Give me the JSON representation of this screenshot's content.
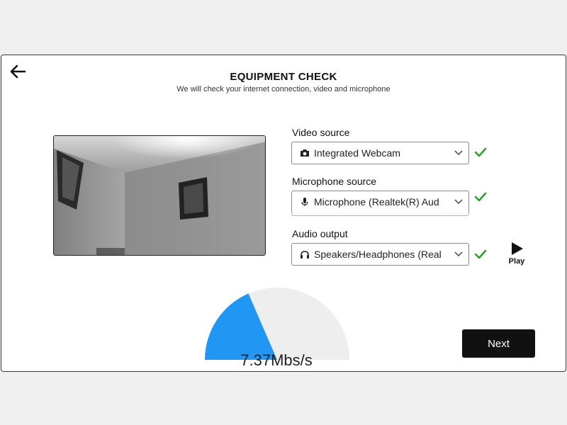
{
  "header": {
    "title": "EQUIPMENT CHECK",
    "subtitle": "We will check your internet connection, video and microphone",
    "back_icon": "arrow-left-icon"
  },
  "video_preview": {
    "content": "webcam-feed-room"
  },
  "devices": {
    "video_source": {
      "label": "Video source",
      "value": "Integrated Webcam",
      "icon": "camera-icon",
      "status": "ok"
    },
    "microphone_source": {
      "label": "Microphone source",
      "value": "Microphone (Realtek(R) Aud",
      "icon": "microphone-icon",
      "status": "ok"
    },
    "audio_output": {
      "label": "Audio output",
      "value": "Speakers/Headphones (Real",
      "icon": "headphones-icon",
      "status": "ok"
    }
  },
  "play_button": {
    "label": "Play",
    "icon": "play-icon"
  },
  "speed_test": {
    "value_text": "7.37Mbs/s",
    "fill_fraction": 0.37
  },
  "next_button": {
    "label": "Next"
  },
  "colors": {
    "accent_blue": "#2196f3",
    "check_green": "#2e9e2e",
    "gauge_track": "#eeeeee",
    "button_dark": "#111111"
  }
}
